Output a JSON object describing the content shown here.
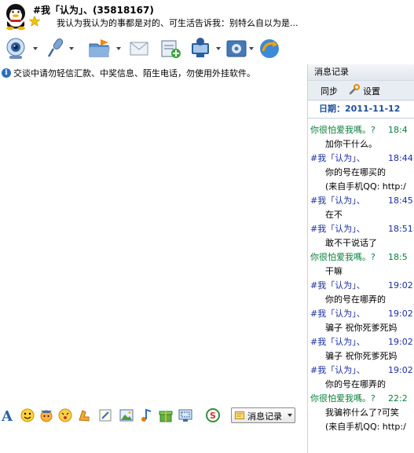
{
  "header": {
    "contact_name": "#我「认为」、(35818167)",
    "signature": "我认为我认为的事都是对的、可生活告诉我：别特么自以为是..."
  },
  "toolbar": {
    "items": [
      {
        "name": "video-call-icon"
      },
      {
        "name": "voice-call-icon"
      },
      {
        "name": "send-file-icon"
      },
      {
        "name": "send-mail-icon"
      },
      {
        "name": "create-group-icon"
      },
      {
        "name": "remote-assist-icon"
      },
      {
        "name": "apps-icon"
      },
      {
        "name": "share-icon"
      }
    ]
  },
  "warning": {
    "text": "交谈中请勿轻信汇款、中奖信息、陌生电话，勿使用外挂软件。"
  },
  "input_toolbar": {
    "icons": [
      "font-icon",
      "emoticon-icon",
      "magic-emoticon-icon",
      "nudge-icon",
      "voice-message-icon",
      "doodle-icon",
      "image-icon",
      "music-icon",
      "gift-icon",
      "screenshot-icon",
      "search-icon"
    ],
    "history_button_label": "消息记录"
  },
  "history": {
    "title": "消息记录",
    "sync_label": "同步",
    "settings_label": "设置",
    "date_label": "日期：2011-11-12",
    "messages": [
      {
        "sender": "你很怕爱我嗎。?",
        "time": "18:4",
        "text": "加你干什么。",
        "self": true
      },
      {
        "sender": "#我「认为」、",
        "time": "18:44:",
        "text": "你的号在哪买的\n(来自手机QQ: http:/",
        "self": false
      },
      {
        "sender": "#我「认为」、",
        "time": "18:45:",
        "text": "在不",
        "self": false
      },
      {
        "sender": "#我「认为」、",
        "time": "18:51:",
        "text": "敢不干说话了",
        "self": false
      },
      {
        "sender": "你很怕爱我嗎。?",
        "time": "18:5",
        "text": "干嘛",
        "self": true
      },
      {
        "sender": "#我「认为」、",
        "time": "19:02:",
        "text": "你的号在哪弄的",
        "self": false
      },
      {
        "sender": "#我「认为」、",
        "time": "19:02:",
        "text": "骗子 祝你死爹死妈",
        "self": false
      },
      {
        "sender": "#我「认为」、",
        "time": "19:02:",
        "text": "骗子 祝你死爹死妈",
        "self": false
      },
      {
        "sender": "#我「认为」、",
        "time": "19:02:",
        "text": "你的号在哪弄的",
        "self": false
      },
      {
        "sender": "你很怕爱我嗎。?",
        "time": "22:2",
        "text": "我骗祢什么了?可笑\n(来自手机QQ: http:/",
        "self": true
      }
    ]
  },
  "colors": {
    "self_sender": "#0b7d3a",
    "other_sender": "#1a2fa0",
    "date": "#1a4f9c",
    "panel_border": "#c7d3e3"
  }
}
